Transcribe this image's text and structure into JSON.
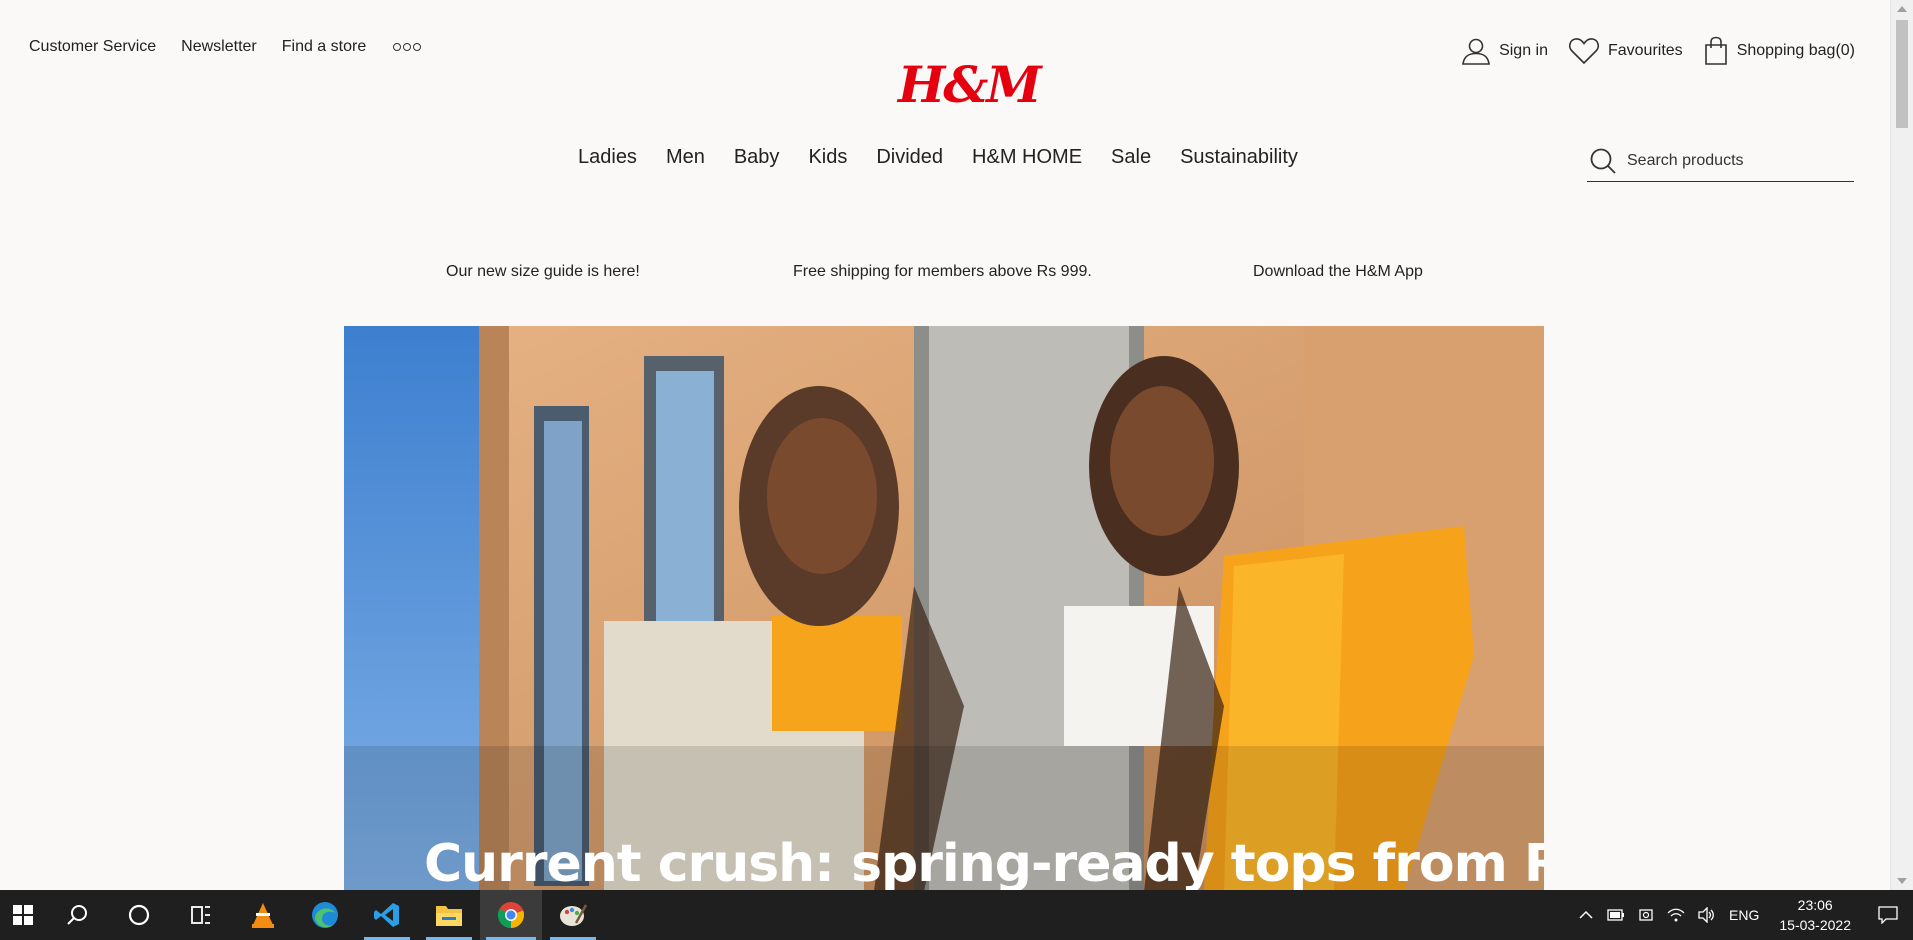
{
  "header": {
    "top_links": [
      "Customer Service",
      "Newsletter",
      "Find a store"
    ],
    "logo_text": "H&M",
    "account": {
      "sign_in": "Sign in",
      "favourites": "Favourites",
      "bag": "Shopping bag(0)"
    }
  },
  "nav": {
    "items": [
      "Ladies",
      "Men",
      "Baby",
      "Kids",
      "Divided",
      "H&M HOME",
      "Sale",
      "Sustainability"
    ]
  },
  "search": {
    "placeholder": "Search products"
  },
  "promos": [
    "Our new size guide is here!",
    "Free shipping for members above Rs 999.",
    "Download the H&M App"
  ],
  "hero": {
    "headline": "Current crush: spring-ready tops from Rs."
  },
  "taskbar": {
    "apps": [
      "start-icon",
      "search-icon",
      "cortana-icon",
      "task-view-icon",
      "vlc-icon",
      "edge-icon",
      "vscode-icon",
      "file-explorer-icon",
      "chrome-icon",
      "paint-icon"
    ],
    "language": "ENG",
    "time": "23:06",
    "date": "15-03-2022"
  },
  "colors": {
    "brand_red": "#e50010",
    "taskbar": "#1f1f1f",
    "hero_orange": "#f6a21a"
  }
}
